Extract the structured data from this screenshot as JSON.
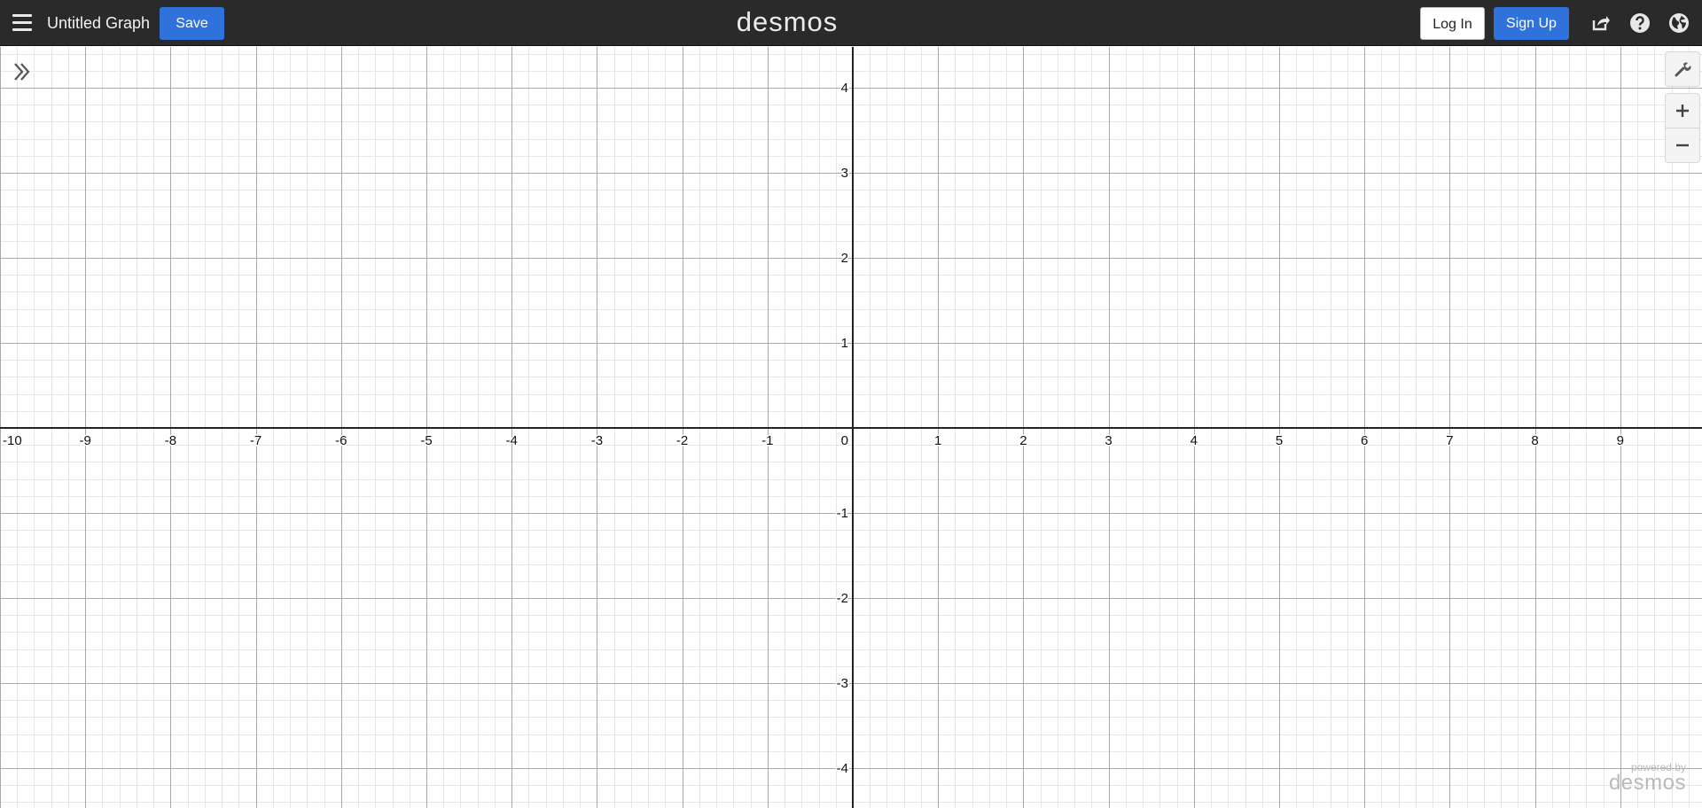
{
  "header": {
    "graph_title": "Untitled Graph",
    "save_label": "Save",
    "brand": "desmos",
    "login_label": "Log In",
    "signup_label": "Sign Up",
    "icons": [
      "menu-icon",
      "share-icon",
      "help-icon",
      "language-globe-icon"
    ]
  },
  "graph": {
    "x_range": [
      -10,
      10
    ],
    "y_range": [
      -4.5,
      4.5
    ],
    "major_step": 1,
    "minor_divisions": 5,
    "x_tick_labels": [
      "-10",
      "-9",
      "-8",
      "-7",
      "-6",
      "-5",
      "-4",
      "-3",
      "-2",
      "-1",
      "0",
      "1",
      "2",
      "3",
      "4",
      "5",
      "6",
      "7",
      "8",
      "9"
    ],
    "y_tick_labels": [
      "4",
      "3",
      "2",
      "1",
      "-1",
      "-2",
      "-3",
      "-4"
    ],
    "grid": true
  },
  "controls": {
    "icons": [
      "expand-panel-icon",
      "wrench-icon",
      "zoom-in-icon",
      "zoom-out-icon"
    ]
  },
  "watermark": {
    "powered_by": "powered by",
    "brand": "desmos"
  },
  "colors": {
    "header_bg": "#2a2a2a",
    "accent_blue": "#2f72dc",
    "axis": "#222222",
    "major_grid": "#a8a8a8",
    "minor_grid": "#e6e6e6"
  }
}
